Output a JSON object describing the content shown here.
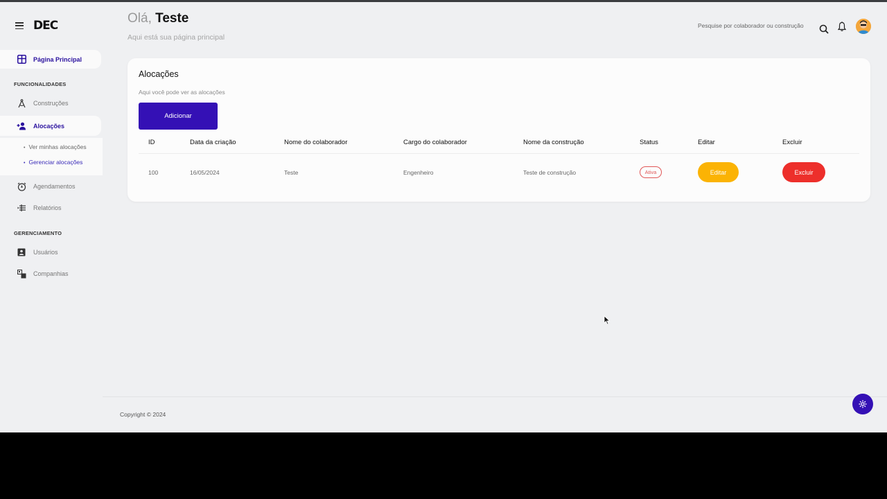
{
  "brand": {
    "logo": "DEC"
  },
  "header": {
    "greeting_prefix": "Olá,",
    "user_name": "Teste",
    "subtitle": "Aqui está sua página principal",
    "search_placeholder": "Pesquise por colaborador ou construção"
  },
  "sidebar": {
    "home": "Página Principal",
    "section_features": "FUNCIONALIDADES",
    "constructions": "Construções",
    "allocations": "Alocações",
    "sub_view": "Ver minhas alocações",
    "sub_manage": "Gerenciar alocações",
    "schedules": "Agendamentos",
    "reports": "Relatórios",
    "section_management": "GERENCIAMENTO",
    "users": "Usuários",
    "companies": "Companhias"
  },
  "card": {
    "title": "Alocações",
    "subtitle": "Aqui você pode ver as alocações",
    "add_label": "Adicionar"
  },
  "table": {
    "headers": [
      "ID",
      "Data da criação",
      "Nome do colaborador",
      "Cargo do colaborador",
      "Nome da construção",
      "Status",
      "Editar",
      "Excluir"
    ],
    "rows": [
      {
        "id": "100",
        "date": "16/05/2024",
        "collaborator": "Teste",
        "role": "Engenheiro",
        "construction": "Teste de construção",
        "status": "Ativa",
        "edit": "Editar",
        "delete": "Excluir"
      }
    ]
  },
  "footer": {
    "copyright": "Copyright © 2024"
  },
  "colors": {
    "primary": "#3410b5",
    "edit": "#fbb304",
    "delete": "#ed2f2b",
    "status_active": "#e05656"
  }
}
